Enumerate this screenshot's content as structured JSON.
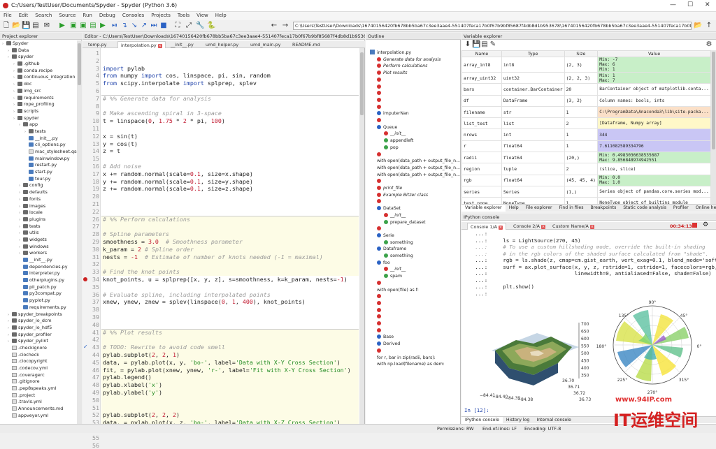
{
  "window": {
    "title": "C:/Users/TestUser/Documents/Spyder - Spyder (Python 3.6)"
  },
  "menu": [
    "File",
    "Edit",
    "Search",
    "Source",
    "Run",
    "Debug",
    "Consoles",
    "Projects",
    "Tools",
    "View",
    "Help"
  ],
  "toolbar": {
    "path": "C:\\Users\\TestUser\\Downloads\\16740156420fb678bb5ba67c3ee3aae4-551407feca17b0f67b9bf85687f4db8d1b953678\\16740156420fb678bb5ba67c3ee3aae4-551407feca17b0f67b9bf85687f4db8d1b953678"
  },
  "project": {
    "title": "Project explorer",
    "items": [
      [
        "Spyder",
        0,
        "fold"
      ],
      [
        "Data",
        1,
        "fold"
      ],
      [
        "spyder",
        1,
        "fold"
      ],
      [
        ".github",
        2,
        "fold"
      ],
      [
        "conda.recipe",
        2,
        "fold"
      ],
      [
        "continuous_integration",
        2,
        "fold"
      ],
      [
        "doc",
        2,
        "fold"
      ],
      [
        "img_src",
        2,
        "fold"
      ],
      [
        "requirements",
        2,
        "fold"
      ],
      [
        "rope_profiling",
        2,
        "fold"
      ],
      [
        "scripts",
        2,
        "fold"
      ],
      [
        "spyder",
        2,
        "fold"
      ],
      [
        "app",
        3,
        "fold"
      ],
      [
        "tests",
        4,
        "fold"
      ],
      [
        "__init__.py",
        4,
        "py"
      ],
      [
        "cli_options.py",
        4,
        "py"
      ],
      [
        "mac_stylesheet.qss",
        4,
        "file"
      ],
      [
        "mainwindow.py",
        4,
        "py"
      ],
      [
        "restart.py",
        4,
        "py"
      ],
      [
        "start.py",
        4,
        "py"
      ],
      [
        "tour.py",
        4,
        "py"
      ],
      [
        "config",
        3,
        "fold"
      ],
      [
        "defaults",
        3,
        "fold"
      ],
      [
        "fonts",
        3,
        "fold"
      ],
      [
        "images",
        3,
        "fold"
      ],
      [
        "locale",
        3,
        "fold"
      ],
      [
        "plugins",
        3,
        "fold"
      ],
      [
        "tests",
        3,
        "fold"
      ],
      [
        "utils",
        3,
        "fold"
      ],
      [
        "widgets",
        3,
        "fold"
      ],
      [
        "windows",
        3,
        "fold"
      ],
      [
        "workers",
        3,
        "fold"
      ],
      [
        "__init__.py",
        3,
        "py"
      ],
      [
        "dependencies.py",
        3,
        "py"
      ],
      [
        "interpreter.py",
        3,
        "py"
      ],
      [
        "otherplugins.py",
        3,
        "py"
      ],
      [
        "pil_patch.py",
        3,
        "py"
      ],
      [
        "py3compat.py",
        3,
        "py"
      ],
      [
        "pyplot.py",
        3,
        "py"
      ],
      [
        "requirements.py",
        3,
        "py"
      ],
      [
        "spyder_breakpoints",
        1,
        "fold"
      ],
      [
        "spyder_io_dcm",
        1,
        "fold"
      ],
      [
        "spyder_io_hdf5",
        1,
        "fold"
      ],
      [
        "spyder_profiler",
        1,
        "fold"
      ],
      [
        "spyder_pylint",
        1,
        "fold"
      ],
      [
        ".checkignore",
        1,
        "file"
      ],
      [
        ".ciocheck",
        1,
        "file"
      ],
      [
        ".ciocopyright",
        1,
        "file"
      ],
      [
        ".codecov.yml",
        1,
        "file"
      ],
      [
        ".coveragerc",
        1,
        "file"
      ],
      [
        ".gitignore",
        1,
        "file"
      ],
      [
        ".pep8speaks.yml",
        1,
        "file"
      ],
      [
        ".project",
        1,
        "file"
      ],
      [
        ".travis.yml",
        1,
        "file"
      ],
      [
        "Announcements.md",
        1,
        "file"
      ],
      [
        "appveyor.yml",
        1,
        "file"
      ]
    ]
  },
  "editor": {
    "title": "Editor - C:\\Users\\TestUser\\Downloads\\16740156420fb678bb5ba67c3ee3aae4-551407feca17b0f67b9bf85687f4db8d1b953678",
    "tabs": [
      "temp.py",
      "interpolation.py",
      "__init__.py",
      "umd_helper.py",
      "umd_main.py",
      "README.md"
    ],
    "lines": [
      [
        1,
        ""
      ],
      [
        2,
        ""
      ],
      [
        3,
        "[k]import[/] pylab"
      ],
      [
        4,
        "[k]from[/] numpy [k]import[/] cos, linspace, pi, sin, random"
      ],
      [
        5,
        "[k]from[/] scipy.interpolate [k]import[/] splprep, splev"
      ],
      [
        6,
        ""
      ],
      [
        7,
        "[h]# %% Generate data for analysis[/]"
      ],
      [
        8,
        ""
      ],
      [
        9,
        "[c]# Make ascending spiral in 3-space[/]"
      ],
      [
        10,
        "t = linspace([n]0[/], [n]1.75[/] * [n]2[/] * pi, [n]100[/])"
      ],
      [
        11,
        ""
      ],
      [
        12,
        "x = sin(t)"
      ],
      [
        13,
        "y = cos(t)"
      ],
      [
        14,
        "z = t"
      ],
      [
        15,
        ""
      ],
      [
        16,
        "[c]# Add noise[/]"
      ],
      [
        17,
        "x += random.normal(scale=[n]0.1[/], size=x.shape)"
      ],
      [
        18,
        "y += random.normal(scale=[n]0.1[/], size=y.shape)"
      ],
      [
        19,
        "z += random.normal(scale=[n]0.1[/], size=z.shape)"
      ],
      [
        20,
        ""
      ],
      [
        21,
        ""
      ],
      [
        22,
        ""
      ],
      [
        26,
        "[h]# %% Perform calculations[/]"
      ],
      [
        27,
        ""
      ],
      [
        28,
        "[c]# Spline parameters[/]"
      ],
      [
        29,
        "smoothness = [n]3.0[/]  [c]# Smoothness parameter[/]"
      ],
      [
        30,
        "k_param = [n]2[/] [c]# Spline order[/]"
      ],
      [
        31,
        "nests = [n]-1[/]  [c]# Estimate of number of knots needed (-1 = maximal)[/]"
      ],
      [
        32,
        ""
      ],
      [
        33,
        "[c]# Find the knot points[/]"
      ],
      [
        34,
        "knot_points, u = splprep([x, y, z], s=smoothness, k=k_param, nests=[n]-1[/])"
      ],
      [
        35,
        ""
      ],
      [
        36,
        "[c]# Evaluate spline, including interpolated points[/]"
      ],
      [
        37,
        "xnew, ynew, znew = splev(linspace([n]0[/], [n]1[/], [n]400[/]), knot_points)"
      ],
      [
        38,
        ""
      ],
      [
        39,
        ""
      ],
      [
        40,
        ""
      ],
      [
        41,
        "[h]# %% Plot results[/]"
      ],
      [
        42,
        ""
      ],
      [
        43,
        "[c]# TODO: Rewrite to avoid code smell[/]"
      ],
      [
        44,
        "pylab.subplot([n]2[/], [n]2[/], [n]1[/])"
      ],
      [
        45,
        "data, = pylab.plot(x, y, [s]'bo-'[/], label=[s]'Data with X-Y Cross Section'[/])"
      ],
      [
        46,
        "fit, = pylab.plot(xnew, ynew, [s]'r-'[/], label=[s]'Fit with X-Y Cross Section'[/])"
      ],
      [
        47,
        "pylab.legend()"
      ],
      [
        48,
        "pylab.xlabel([s]'x'[/])"
      ],
      [
        49,
        "pylab.ylabel([s]'y'[/])"
      ],
      [
        50,
        ""
      ],
      [
        51,
        ""
      ],
      [
        52,
        "pylab.subplot([n]2[/], [n]2[/], [n]2[/])"
      ],
      [
        53,
        "data, = pylab.plot(x, z, [s]'bo-'[/], label=[s]'Data with X-Z Cross Section'[/])"
      ],
      [
        54,
        "fit, = pylab.plot(xnew, znew, [s]'r-'[/], label=[s]'Fit with X-Z Cross Section'[/])"
      ],
      [
        55,
        "pylab.legend()"
      ],
      [
        56,
        "pylab.xlabel([s]'x'[/])"
      ]
    ]
  },
  "outline": {
    "title": "Outline",
    "items": [
      [
        "interpolation.py",
        0,
        "file"
      ],
      [
        "Generate data for analysis",
        1,
        "red"
      ],
      [
        "Perform calculations",
        1,
        "red"
      ],
      [
        "Plot results",
        1,
        "red"
      ],
      [
        "",
        1,
        "red"
      ],
      [
        "",
        1,
        "red"
      ],
      [
        "",
        1,
        "red"
      ],
      [
        "",
        1,
        "red"
      ],
      [
        "",
        1,
        "red"
      ],
      [
        "imputerNan",
        1,
        "blue"
      ],
      [
        "",
        1,
        "red"
      ],
      [
        "Queue",
        1,
        "blue"
      ],
      [
        "__init__",
        2,
        "red"
      ],
      [
        "appendleft",
        2,
        "green"
      ],
      [
        "pop",
        2,
        "green"
      ],
      [
        "",
        1,
        "red"
      ],
      [
        "with open(data_path + output_file_n...",
        1,
        "none"
      ],
      [
        "with open(data_path + output_file_n...",
        1,
        "none"
      ],
      [
        "with open(data_path + output_file_n...",
        1,
        "none"
      ],
      [
        "",
        1,
        "red"
      ],
      [
        "print_file",
        1,
        "red"
      ],
      [
        "Example Bitzer class",
        1,
        "red"
      ],
      [
        "",
        1,
        "red"
      ],
      [
        "DataSet",
        1,
        "blue"
      ],
      [
        "__init__",
        2,
        "red"
      ],
      [
        "prepare_dataset",
        2,
        "green"
      ],
      [
        "",
        1,
        "red"
      ],
      [
        "Serie",
        1,
        "blue"
      ],
      [
        "something",
        2,
        "green"
      ],
      [
        "Dataframe",
        1,
        "blue"
      ],
      [
        "something",
        2,
        "green"
      ],
      [
        "foo",
        1,
        "blue"
      ],
      [
        "__init__",
        2,
        "red"
      ],
      [
        "spam",
        2,
        "green"
      ],
      [
        "",
        1,
        "red"
      ],
      [
        "with open(file) as f:",
        1,
        "none"
      ],
      [
        "",
        1,
        "red"
      ],
      [
        "",
        1,
        "red"
      ],
      [
        "",
        1,
        "red"
      ],
      [
        "",
        1,
        "red"
      ],
      [
        "",
        1,
        "red"
      ],
      [
        "",
        1,
        "red"
      ],
      [
        "Base",
        1,
        "blue"
      ],
      [
        "Derived",
        1,
        "blue"
      ],
      [
        "",
        1,
        "red"
      ],
      [
        "for r, bar in zip(radii, bars):",
        1,
        "none"
      ],
      [
        "with np.load(filename) as dem:",
        1,
        "none"
      ]
    ]
  },
  "varexplorer": {
    "title": "Variable explorer",
    "headers": [
      "Name",
      "Type",
      "Size",
      "Value"
    ],
    "rows": [
      [
        "array_int8",
        "int8",
        "(2, 3)",
        "Min: -7\nMax: 6\nMin: 1",
        "#c8efc8"
      ],
      [
        "array_uint32",
        "uint32",
        "(2, 2, 3)",
        "Min: 1\nMax: 7",
        "#c8efc8"
      ],
      [
        "bars",
        "container.BarContainer",
        "20",
        "BarContainer object of matplotlib.conta...",
        "#fff"
      ],
      [
        "df",
        "DataFrame",
        "(3, 2)",
        "Column names: bools, ints",
        "#fff"
      ],
      [
        "filename",
        "str",
        "1",
        "C:\\ProgramData\\Anaconda3\\lib\\site-packa...",
        "#fbe0c8"
      ],
      [
        "list_test",
        "list",
        "2",
        "[Dataframe, Numpy array]",
        "#fff8c8"
      ],
      [
        "nrows",
        "int",
        "1",
        "344",
        "#c9c6f5"
      ],
      [
        "r",
        "float64",
        "1",
        "7.611082589334796",
        "#c9c6f5"
      ],
      [
        "radii",
        "float64",
        "(20,)",
        "Min: 0.4983036638535687\nMax: 9.856848974942551",
        "#c8efc8"
      ],
      [
        "region",
        "tuple",
        "2",
        "(slice, slice)",
        "#fff"
      ],
      [
        "rgb",
        "float64",
        "(45, 45, 4)",
        "Min: 0.0\nMax: 1.0",
        "#c8efc8"
      ],
      [
        "series",
        "Series",
        "(1,)",
        "Series object of pandas.core.series mod...",
        "#fff"
      ],
      [
        "test_none",
        "NoneType",
        "1",
        "NoneType object of builtins module",
        "#fff"
      ]
    ],
    "bottom_tabs": [
      "Variable explorer",
      "Help",
      "File explorer",
      "Find in files",
      "Breakpoints",
      "Static code analysis",
      "Profiler",
      "Online help"
    ]
  },
  "console": {
    "title": "IPython console",
    "tabs": [
      "Console 1/A",
      "Console 2/A",
      "Custom Name/A"
    ],
    "timer": "00:34:13",
    "lines": [
      "   ...: ",
      "   ...:     ls = LightSource(270, 45)",
      "   ...:     # To use a custom hillshading mode, override the built-in shading",
      "   ...:     # in the rgb colors of the shaded surface calculated from \"shade\".",
      "   ...:     rgb = ls.shade(z, cmap=cm.gist_earth, vert_exag=0.1, blend_mode='soft')",
      "   ...:     surf = ax.plot_surface(x, y, z, rstride=1, cstride=1, facecolors=rgb,",
      "   ...:                            linewidth=0, antialiased=False, shade=False)",
      "   ...: ",
      "   ...:     plt.show()",
      "   ...: "
    ],
    "prompt": "In [12]:",
    "bottom_tabs": [
      "IPython console",
      "History log",
      "Internal console"
    ],
    "surface_ticks": [
      "700",
      "650",
      "600",
      "550",
      "500",
      "450",
      "400",
      "350"
    ],
    "xticks": [
      "−84.41",
      "−84.40",
      "−84.39",
      "−84.38"
    ],
    "yticks": [
      "36.73",
      "36.72",
      "36.71",
      "36.70"
    ],
    "polar_labels": [
      "90°",
      "135°",
      "45°",
      "180°",
      "0°",
      "225°",
      "315°",
      "270°"
    ]
  },
  "status": {
    "permissions": "Permissions: RW",
    "eol": "End-of-lines: LF",
    "encoding": "Encoding: UTF-8"
  },
  "watermark": {
    "line1": "www.94IP.com",
    "line2": "IT运维空间"
  }
}
